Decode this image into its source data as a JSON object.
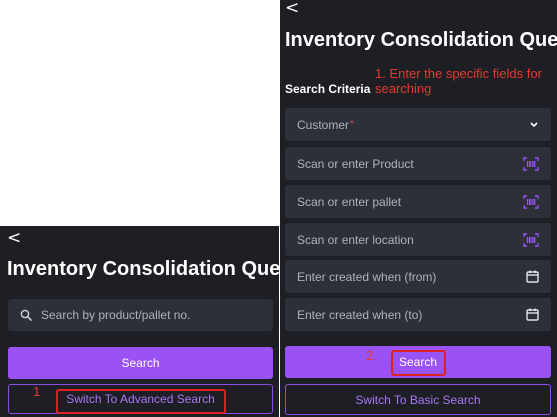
{
  "basic_screen": {
    "back_glyph": "<",
    "title": "Inventory Consolidation Query",
    "search": {
      "icon": "search-icon",
      "placeholder": "Search by product/pallet no."
    },
    "search_button": "Search",
    "switch_button": "Switch To Advanced Search",
    "annotation_number": "1"
  },
  "advanced_screen": {
    "back_glyph": "<",
    "title": "Inventory Consolidation Query",
    "section_label": "Search Criteria",
    "annotation_note": "1. Enter the specific fields for searching",
    "fields": {
      "customer": "Customer",
      "customer_required_mark": "*",
      "product": "Scan or enter Product",
      "pallet": "Scan or enter pallet",
      "location": "Scan or enter location",
      "created_from": "Enter created when (from)",
      "created_to": "Enter created when (to)"
    },
    "search_button": "Search",
    "annotation_number": "2.",
    "switch_button": "Switch To Basic Search"
  },
  "colors": {
    "panel_bg": "#1e1f24",
    "field_bg": "#2d3038",
    "accent": "#9a52f5",
    "annotation": "#e23a2e"
  }
}
